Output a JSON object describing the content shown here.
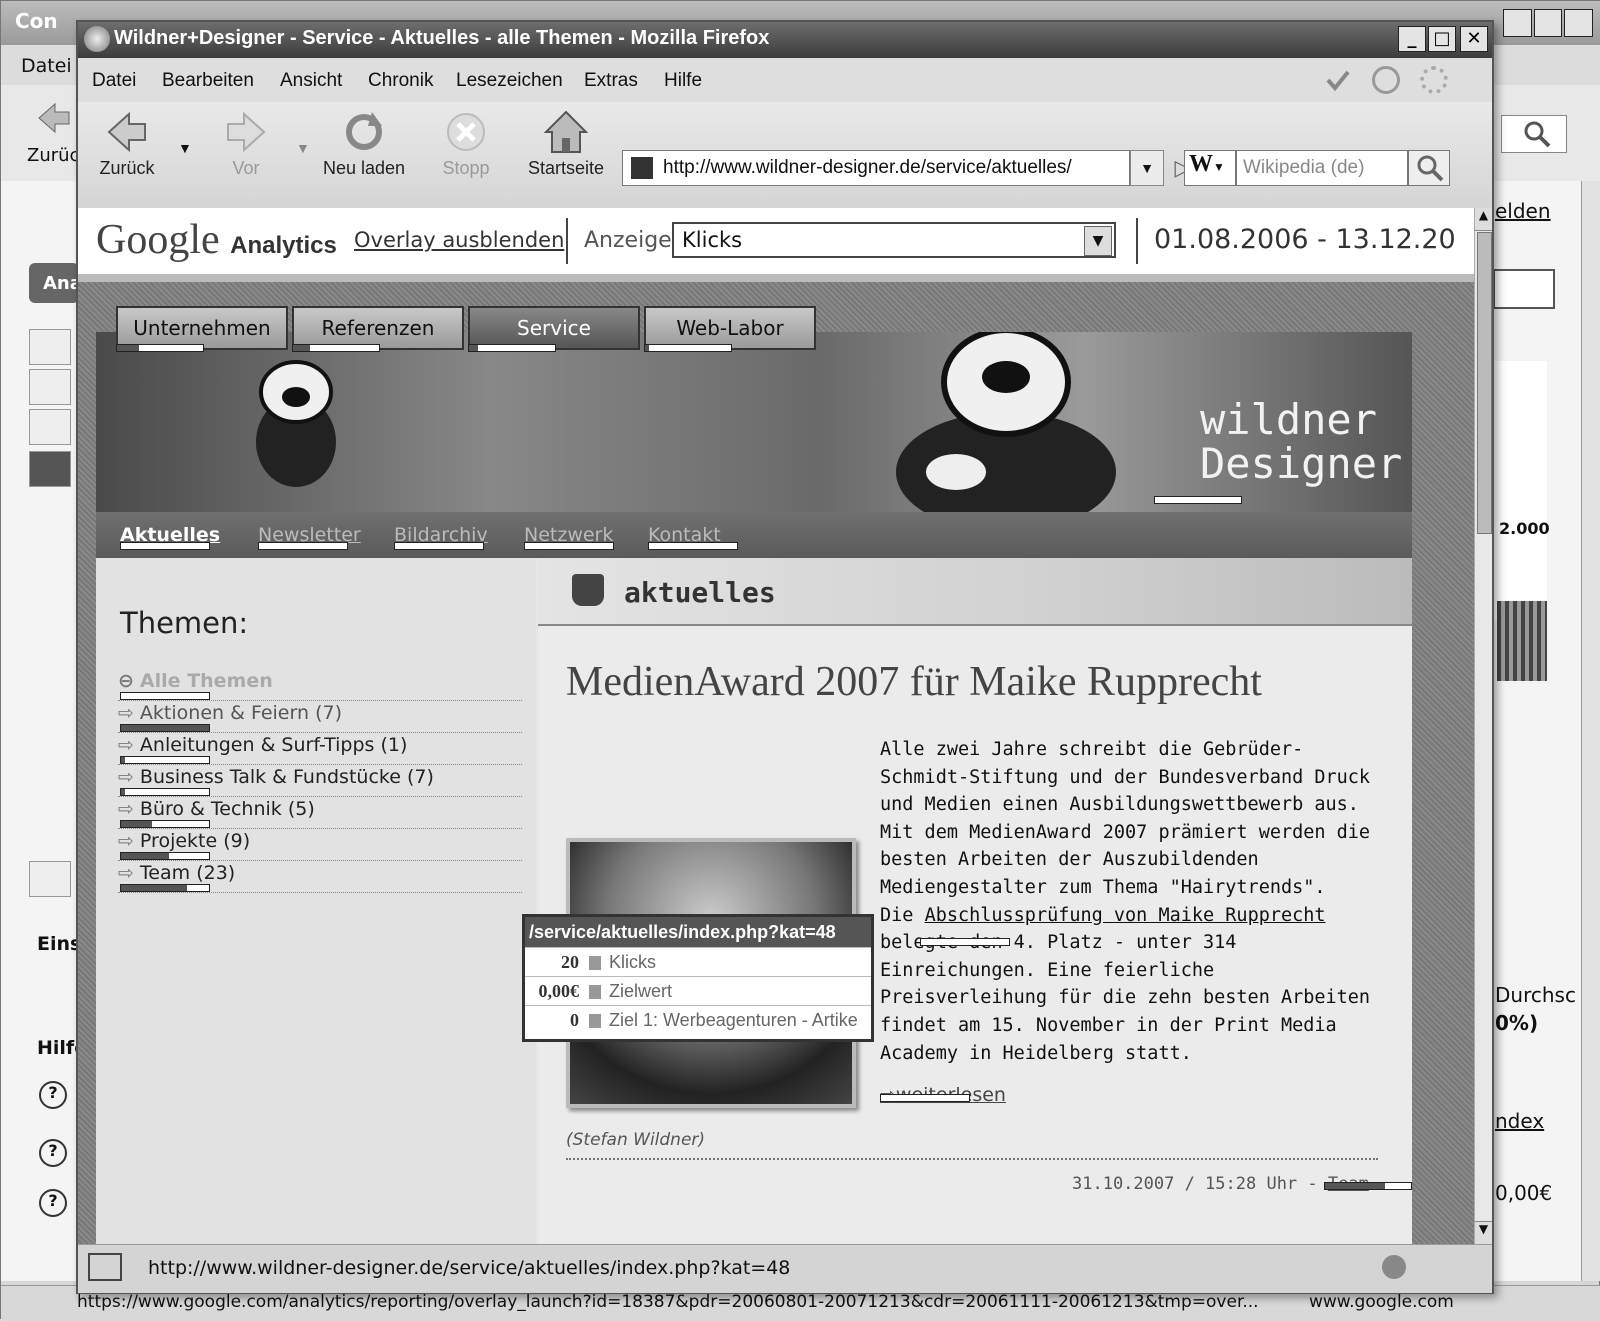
{
  "background_window": {
    "title": "Con",
    "menu_first": "Datei",
    "back_label": "Zurück",
    "heading_fragments": [
      "elden",
      "2.000",
      "Durchsc",
      "0%)",
      "ndex",
      "0,00€",
      "Eins",
      "Hilfe",
      "Ana"
    ],
    "status_url": "https://www.google.com/analytics/reporting/overlay_launch?id=18387&pdr=20060801-20071213&cdr=20061111-20061213&tmp=over...",
    "status_right": "www.google.com"
  },
  "window": {
    "title": "Wildner+Designer - Service - Aktuelles - alle Themen - Mozilla Firefox",
    "min": "_",
    "max": "□",
    "close": "✕"
  },
  "menu": [
    "Datei",
    "Bearbeiten",
    "Ansicht",
    "Chronik",
    "Lesezeichen",
    "Extras",
    "Hilfe"
  ],
  "nav": {
    "back": "Zurück",
    "forward": "Vor",
    "reload": "Neu laden",
    "stop": "Stopp",
    "home": "Startseite",
    "url": "http://www.wildner-designer.de/service/aktuelles/",
    "search_engine": "W",
    "search_placeholder": "Wikipedia (de)"
  },
  "analytics": {
    "logo": "Google",
    "logo_sub": "Analytics",
    "overlay_link": "Overlay ausblenden",
    "anzeige_label": "Anzeige:",
    "anzeige_value": "Klicks",
    "date_range": "01.08.2006 - 13.12.20"
  },
  "site": {
    "top_nav": [
      "Unternehmen",
      "Referenzen",
      "Service",
      "Web-Labor"
    ],
    "top_nav_clicks": [
      0.25,
      0.2,
      0.1,
      0.05
    ],
    "brand_line1": "wildner",
    "brand_line2": "Designer",
    "sub_nav": [
      "Aktuelles",
      "Newsletter",
      "Bildarchiv",
      "Netzwerk",
      "Kontakt"
    ],
    "themen_heading": "Themen:",
    "themen": [
      {
        "label": "Alle Themen",
        "count": ""
      },
      {
        "label": "Aktionen & Feiern",
        "count": "(7)"
      },
      {
        "label": "Anleitungen & Surf-Tipps",
        "count": "(1)"
      },
      {
        "label": "Business Talk & Fundstücke",
        "count": "(7)"
      },
      {
        "label": "Büro & Technik",
        "count": "(5)"
      },
      {
        "label": "Projekte",
        "count": "(9)"
      },
      {
        "label": "Team",
        "count": "(23)"
      }
    ],
    "themen_clicks": [
      0,
      1.0,
      0.05,
      0.05,
      0.35,
      0.55,
      0.75
    ],
    "section_title": "aktuelles",
    "article_title": "MedienAward 2007 für Maike Rupprecht",
    "article_paragraphs": [
      "Alle zwei Jahre schreibt die Gebrüder-Schmidt-Stiftung und der Bundesverband Druck und Medien einen Ausbildungswettbewerb aus.",
      "Mit dem MedienAward 2007 prämiert werden die besten Arbeiten der Auszubildenden Mediengestalter zum Thema \"Hairytrends\"."
    ],
    "article_link_prefix": "Die ",
    "article_link": "Abschlussprüfung von Maike Rupprecht",
    "article_tail": " belegte den 4. Platz - unter 314 Einreichungen. Eine feierliche Preisverleihung für die zehn besten Arbeiten findet am 15. November in der Print Media Academy in Heidelberg statt.",
    "read_more": "weiterlesen",
    "author": "(Stefan Wildner)",
    "date": "31.10.2007 / 15:28 Uhr - ",
    "date_link": "Team"
  },
  "tooltip": {
    "path": "/service/aktuelles/index.php?kat=48",
    "rows": [
      {
        "value": "20",
        "label": "Klicks"
      },
      {
        "value": "0,00€",
        "label": "Zielwert"
      },
      {
        "value": "0",
        "label": "Ziel 1: Werbeagenturen - Artike"
      }
    ]
  },
  "status": {
    "url": "http://www.wildner-designer.de/service/aktuelles/index.php?kat=48"
  }
}
